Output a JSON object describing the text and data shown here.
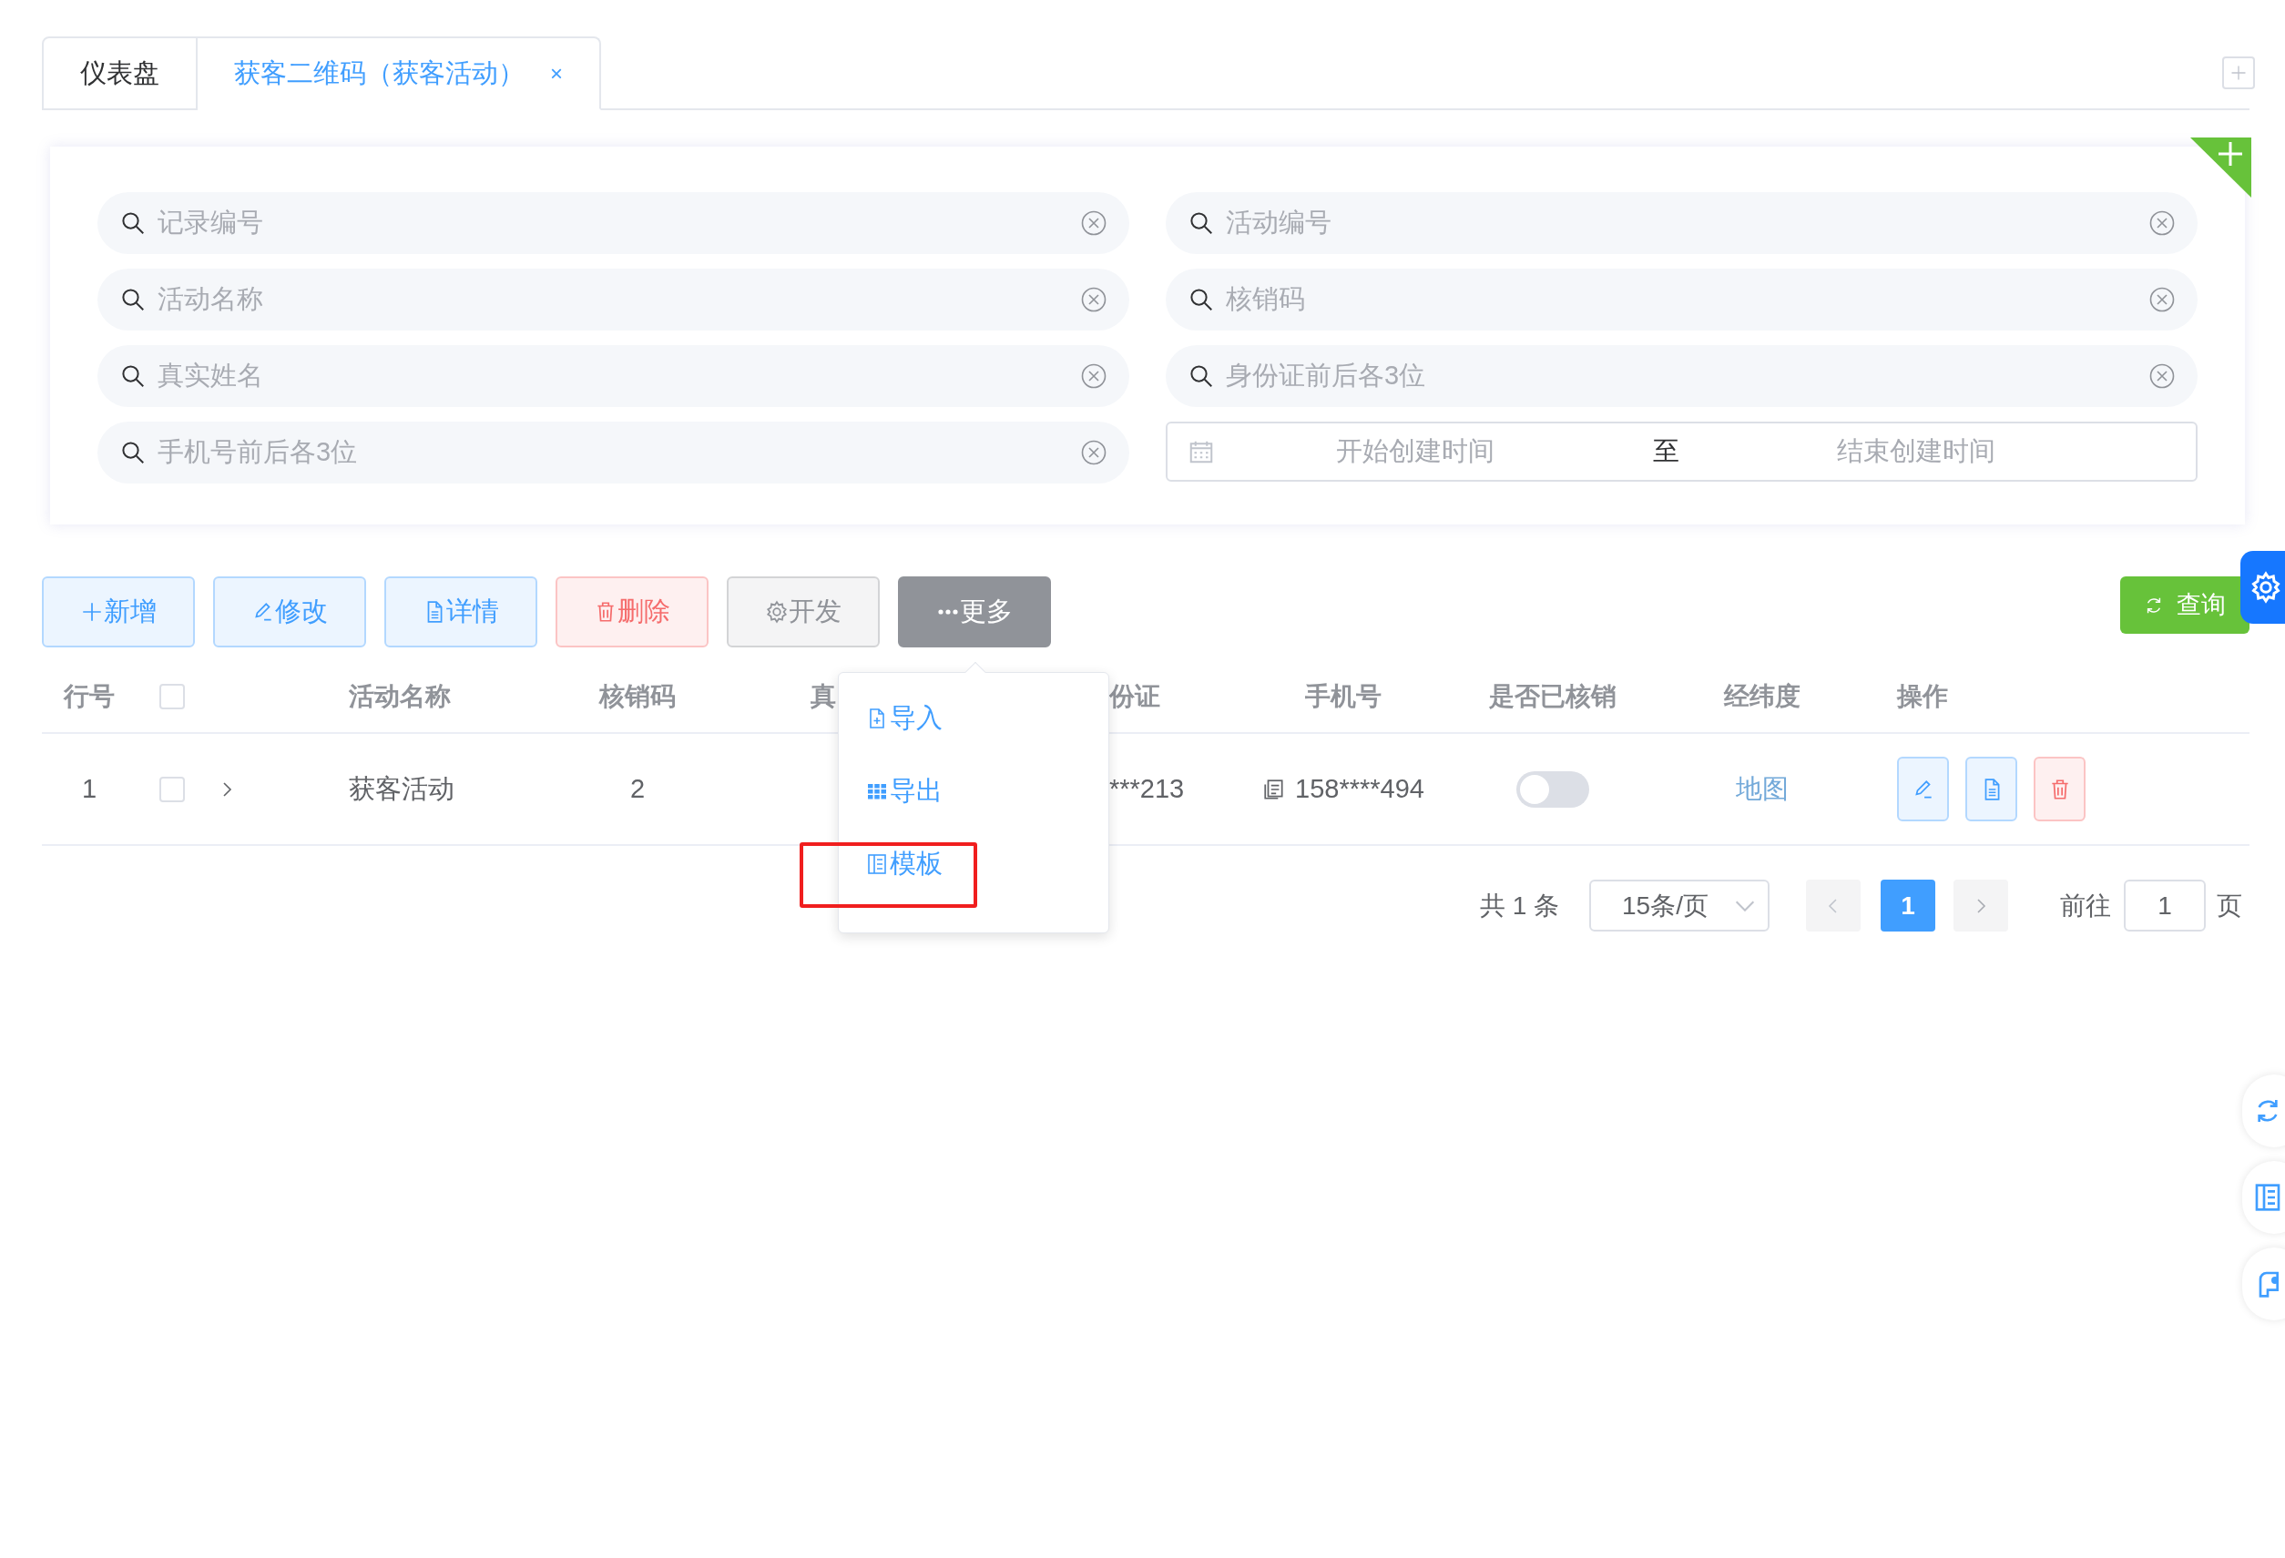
{
  "tabs": [
    {
      "label": "仪表盘",
      "selected": false
    },
    {
      "label": "获客二维码（获客活动）",
      "selected": true,
      "close": "×"
    }
  ],
  "search": {
    "fields": [
      {
        "placeholder": "记录编号"
      },
      {
        "placeholder": "活动编号"
      },
      {
        "placeholder": "活动名称"
      },
      {
        "placeholder": "核销码"
      },
      {
        "placeholder": "真实姓名"
      },
      {
        "placeholder": "身份证前后各3位"
      },
      {
        "placeholder": "手机号前后各3位"
      }
    ],
    "date_range": {
      "start_placeholder": "开始创建时间",
      "separator": "至",
      "end_placeholder": "结束创建时间"
    }
  },
  "toolbar": {
    "buttons": [
      {
        "label": "新增",
        "kind": "primary"
      },
      {
        "label": "修改",
        "kind": "primary"
      },
      {
        "label": "详情",
        "kind": "primary"
      },
      {
        "label": "删除",
        "kind": "danger"
      },
      {
        "label": "开发",
        "kind": "info"
      },
      {
        "label": "更多",
        "kind": "dark"
      }
    ],
    "query_button": {
      "label": "查询"
    }
  },
  "more_menu": {
    "items": [
      {
        "label": "导入",
        "highlighted": false
      },
      {
        "label": "导出",
        "highlighted": false
      },
      {
        "label": "模板",
        "highlighted": true
      }
    ]
  },
  "table": {
    "columns": [
      {
        "kind": "text",
        "label": "行号"
      },
      {
        "kind": "checkbox",
        "checked": false
      },
      {
        "kind": "blank"
      },
      {
        "kind": "text",
        "label": "活动名称"
      },
      {
        "kind": "text",
        "label": "核销码"
      },
      {
        "kind": "text",
        "label": "真"
      },
      {
        "kind": "text",
        "label": "份证"
      },
      {
        "kind": "text",
        "label": "手机号"
      },
      {
        "kind": "text",
        "label": "是否已核销"
      },
      {
        "kind": "text",
        "label": "经纬度"
      },
      {
        "kind": "text",
        "label": "操作"
      }
    ],
    "rows": [
      {
        "number": "1",
        "checked": false,
        "expanded": false,
        "activity_name": "获客活动",
        "code": "2",
        "id_card": "***213",
        "phone": "158****494",
        "verified": false,
        "location": "地图"
      }
    ]
  },
  "pagination": {
    "total": "共 1 条",
    "page_size": "15条/页",
    "pages": [
      {
        "label": "1",
        "selected": true
      }
    ],
    "goto_label": "前往",
    "goto_value": "1",
    "goto_suffix": "页"
  }
}
